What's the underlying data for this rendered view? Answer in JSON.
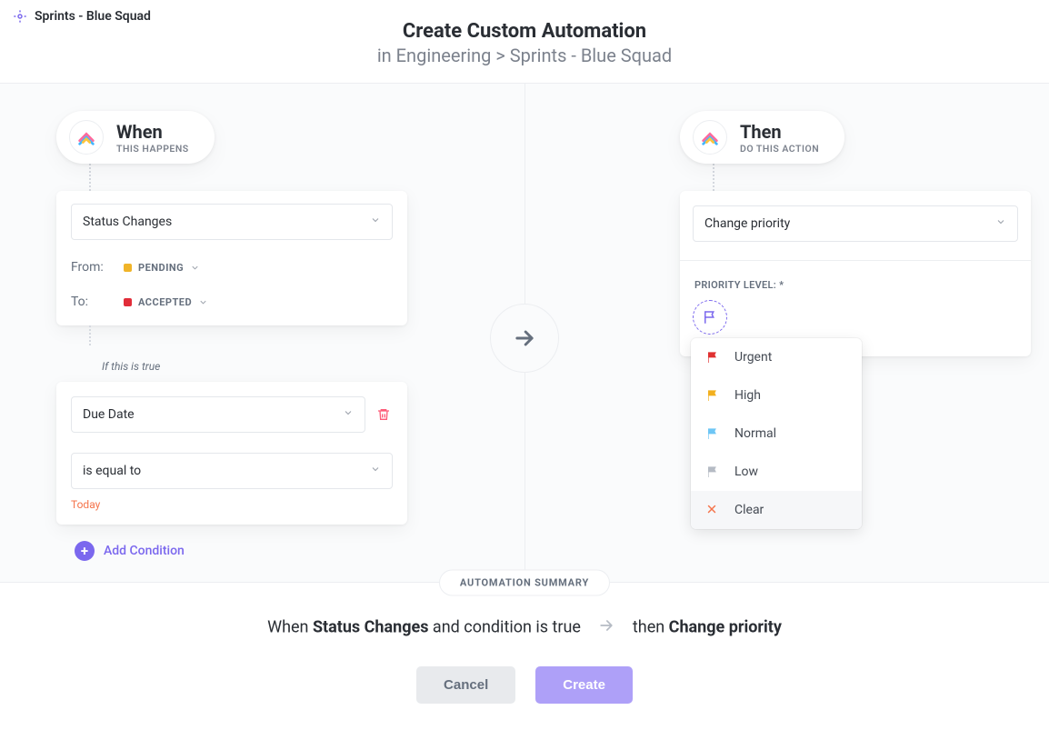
{
  "header": {
    "breadcrumb": "Sprints - Blue Squad",
    "title": "Create Custom Automation",
    "subtitle": "in Engineering > Sprints - Blue Squad"
  },
  "when": {
    "title": "When",
    "subtitle": "THIS HAPPENS",
    "trigger": "Status Changes",
    "from_label": "From:",
    "from_value": "PENDING",
    "from_color": "#f0b429",
    "to_label": "To:",
    "to_value": "ACCEPTED",
    "to_color": "#e12d39"
  },
  "condition": {
    "if_label": "If this is true",
    "field": "Due Date",
    "operator": "is equal to",
    "value_label": "Today",
    "add_label": "Add Condition"
  },
  "then": {
    "title": "Then",
    "subtitle": "DO THIS ACTION",
    "action": "Change priority",
    "priority_label": "PRIORITY LEVEL: *"
  },
  "priority_options": [
    {
      "label": "Urgent",
      "color": "#e03131"
    },
    {
      "label": "High",
      "color": "#f2b01e"
    },
    {
      "label": "Normal",
      "color": "#6ec6f5"
    },
    {
      "label": "Low",
      "color": "#b5bbc4"
    },
    {
      "label": "Clear",
      "color": "#f5744b",
      "clear": true
    }
  ],
  "summary": {
    "badge": "AUTOMATION SUMMARY",
    "prefix": "When ",
    "bold1": "Status Changes",
    "mid": " and condition is true",
    "then_prefix": "then ",
    "bold2": "Change priority"
  },
  "buttons": {
    "cancel": "Cancel",
    "create": "Create"
  }
}
